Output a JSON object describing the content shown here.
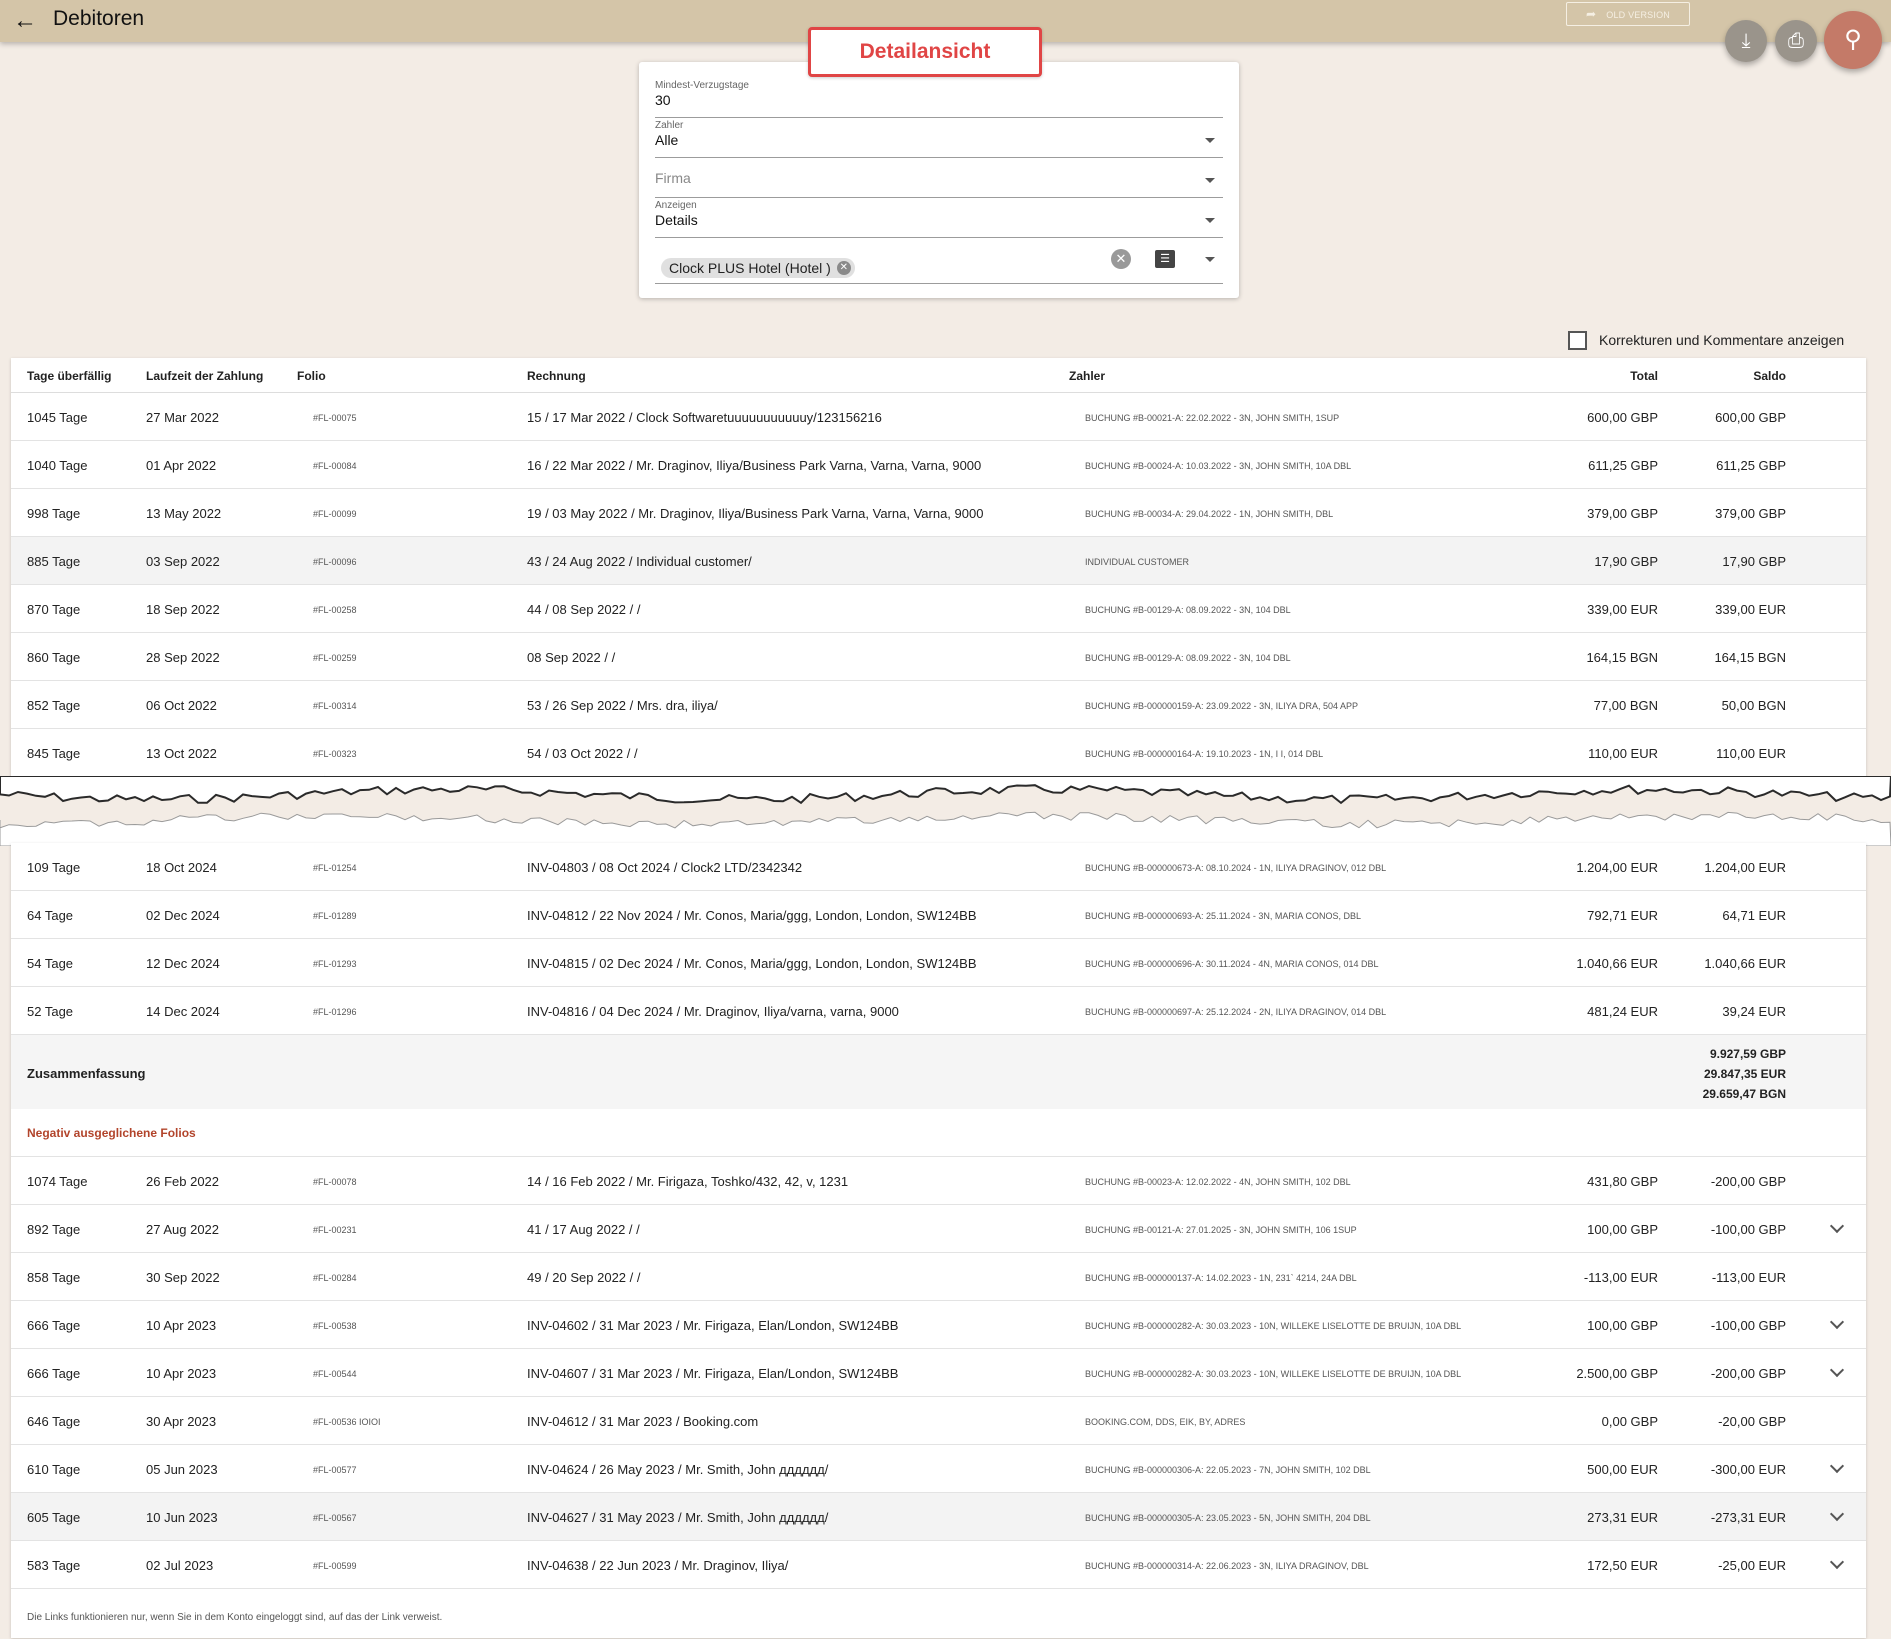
{
  "header": {
    "title": "Debitoren",
    "old_version_label": "OLD VERSION"
  },
  "callout": "Detailansicht",
  "filters": {
    "min_days_label": "Mindest-Verzugstage",
    "min_days_value": "30",
    "payer_label": "Zahler",
    "payer_value": "Alle",
    "company_placeholder": "Firma",
    "show_label": "Anzeigen",
    "show_value": "Details",
    "property_chip": "Clock PLUS Hotel (Hotel )"
  },
  "corrections_label": "Korrekturen und Kommentare anzeigen",
  "columns": {
    "days": "Tage überfällig",
    "term": "Laufzeit der Zahlung",
    "folio": "Folio",
    "invoice": "Rechnung",
    "payer": "Zahler",
    "total": "Total",
    "saldo": "Saldo"
  },
  "rows_top": [
    {
      "days": "1045 Tage",
      "date": "27 Mar 2022",
      "folio": "#FL-00075",
      "invoice": "15 / 17 Mar 2022 / Clock Softwaretuuuuuuuuuuuy/123156216",
      "payer": "BUCHUNG #B-00021-A: 22.02.2022 - 3N, JOHN SMITH, 1SUP",
      "total": "600,00 GBP",
      "saldo": "600,00 GBP"
    },
    {
      "days": "1040 Tage",
      "date": "01 Apr 2022",
      "folio": "#FL-00084",
      "invoice": "16 / 22 Mar 2022 / Mr. Draginov, Iliya/Business Park Varna, Varna, Varna, 9000",
      "payer": "BUCHUNG #B-00024-A: 10.03.2022 - 3N, JOHN SMITH, 10A DBL",
      "total": "611,25 GBP",
      "saldo": "611,25 GBP"
    },
    {
      "days": "998 Tage",
      "date": "13 May 2022",
      "folio": "#FL-00099",
      "invoice": "19 / 03 May 2022 / Mr. Draginov, Iliya/Business Park Varna, Varna, Varna, 9000",
      "payer": "BUCHUNG #B-00034-A: 29.04.2022 - 1N, JOHN SMITH, DBL",
      "total": "379,00 GBP",
      "saldo": "379,00 GBP"
    },
    {
      "days": "885 Tage",
      "date": "03 Sep 2022",
      "folio": "#FL-00096",
      "invoice": "43 / 24 Aug 2022 / Individual customer/",
      "payer": "INDIVIDUAL CUSTOMER",
      "total": "17,90 GBP",
      "saldo": "17,90 GBP",
      "shaded": true
    },
    {
      "days": "870 Tage",
      "date": "18 Sep 2022",
      "folio": "#FL-00258",
      "invoice": "44 / 08 Sep 2022 / /",
      "payer": "BUCHUNG #B-00129-A: 08.09.2022 - 3N, 104 DBL",
      "total": "339,00 EUR",
      "saldo": "339,00 EUR"
    },
    {
      "days": "860 Tage",
      "date": "28 Sep 2022",
      "folio": "#FL-00259",
      "invoice": "08 Sep 2022 / /",
      "payer": "BUCHUNG #B-00129-A: 08.09.2022 - 3N, 104 DBL",
      "total": "164,15 BGN",
      "saldo": "164,15 BGN"
    },
    {
      "days": "852 Tage",
      "date": "06 Oct 2022",
      "folio": "#FL-00314",
      "invoice": "53 / 26 Sep 2022 / Mrs. dra, iliya/",
      "payer": "BUCHUNG #B-000000159-A: 23.09.2022 - 3N, ILIYA DRA, 504 APP",
      "total": "77,00 BGN",
      "saldo": "50,00 BGN"
    },
    {
      "days": "845 Tage",
      "date": "13 Oct 2022",
      "folio": "#FL-00323",
      "invoice": "54 / 03 Oct 2022 / /",
      "payer": "BUCHUNG #B-000000164-A: 19.10.2023 - 1N, I I, 014 DBL",
      "total": "110,00 EUR",
      "saldo": "110,00 EUR"
    }
  ],
  "rows_bottom": [
    {
      "days": "109 Tage",
      "date": "18 Oct 2024",
      "folio": "#FL-01254",
      "invoice": "INV-04803 / 08 Oct 2024 / Clock2 LTD/2342342",
      "payer": "BUCHUNG #B-000000673-A: 08.10.2024 - 1N, ILIYA DRAGINOV, 012 DBL",
      "total": "1.204,00 EUR",
      "saldo": "1.204,00 EUR"
    },
    {
      "days": "64 Tage",
      "date": "02 Dec 2024",
      "folio": "#FL-01289",
      "invoice": "INV-04812 / 22 Nov 2024 / Mr. Conos, Maria/ggg, London, London, SW124BB",
      "payer": "BUCHUNG #B-000000693-A: 25.11.2024 - 3N, MARIA CONOS, DBL",
      "total": "792,71 EUR",
      "saldo": "64,71 EUR"
    },
    {
      "days": "54 Tage",
      "date": "12 Dec 2024",
      "folio": "#FL-01293",
      "invoice": "INV-04815 / 02 Dec 2024 / Mr. Conos, Maria/ggg, London, London, SW124BB",
      "payer": "BUCHUNG #B-000000696-A: 30.11.2024 - 4N, MARIA CONOS, 014 DBL",
      "total": "1.040,66 EUR",
      "saldo": "1.040,66 EUR"
    },
    {
      "days": "52 Tage",
      "date": "14 Dec 2024",
      "folio": "#FL-01296",
      "invoice": "INV-04816 / 04 Dec 2024 / Mr. Draginov, Iliya/varna, varna, 9000",
      "payer": "BUCHUNG #B-000000697-A: 25.12.2024 - 2N, ILIYA DRAGINOV, 014 DBL",
      "total": "481,24 EUR",
      "saldo": "39,24 EUR"
    }
  ],
  "summary": {
    "label": "Zusammenfassung",
    "totals": [
      "9.927,59 GBP",
      "29.847,35 EUR",
      "29.659,47 BGN"
    ]
  },
  "negative_heading": "Negativ ausgeglichene Folios",
  "rows_negative": [
    {
      "days": "1074 Tage",
      "date": "26 Feb 2022",
      "folio": "#FL-00078",
      "invoice": "14 / 16 Feb 2022 / Mr. Firigaza, Toshko/432, 42, v, 1231",
      "payer": "BUCHUNG #B-00023-A: 12.02.2022 - 4N, JOHN SMITH, 102 DBL",
      "total": "431,80 GBP",
      "saldo": "-200,00 GBP",
      "expand": false
    },
    {
      "days": "892 Tage",
      "date": "27 Aug 2022",
      "folio": "#FL-00231",
      "invoice": "41 / 17 Aug 2022 / /",
      "payer": "BUCHUNG #B-00121-A: 27.01.2025 - 3N, JOHN SMITH, 106 1SUP",
      "total": "100,00 GBP",
      "saldo": "-100,00 GBP",
      "expand": true
    },
    {
      "days": "858 Tage",
      "date": "30 Sep 2022",
      "folio": "#FL-00284",
      "invoice": "49 / 20 Sep 2022 / /",
      "payer": "BUCHUNG #B-000000137-A: 14.02.2023 - 1N, 231` 4214, 24A DBL",
      "total": "-113,00 EUR",
      "saldo": "-113,00 EUR",
      "expand": false
    },
    {
      "days": "666 Tage",
      "date": "10 Apr 2023",
      "folio": "#FL-00538",
      "invoice": "INV-04602 / 31 Mar 2023 / Mr. Firigaza, Elan/London, SW124BB",
      "payer": "BUCHUNG #B-000000282-A: 30.03.2023 - 10N, WILLEKE LISELOTTE DE BRUIJN, 10A DBL",
      "total": "100,00 GBP",
      "saldo": "-100,00 GBP",
      "expand": true
    },
    {
      "days": "666 Tage",
      "date": "10 Apr 2023",
      "folio": "#FL-00544",
      "invoice": "INV-04607 / 31 Mar 2023 / Mr. Firigaza, Elan/London, SW124BB",
      "payer": "BUCHUNG #B-000000282-A: 30.03.2023 - 10N, WILLEKE LISELOTTE DE BRUIJN, 10A DBL",
      "total": "2.500,00 GBP",
      "saldo": "-200,00 GBP",
      "expand": true
    },
    {
      "days": "646 Tage",
      "date": "30 Apr 2023",
      "folio": "#FL-00536 IOIOI",
      "invoice": "INV-04612 / 31 Mar 2023 / Booking.com",
      "payer": "BOOKING.COM, DDS, EIK, BY, ADRES",
      "total": "0,00 GBP",
      "saldo": "-20,00 GBP",
      "expand": false
    },
    {
      "days": "610 Tage",
      "date": "05 Jun 2023",
      "folio": "#FL-00577",
      "invoice": "INV-04624 / 26 May 2023 / Mr. Smith, John дддддд/",
      "payer": "BUCHUNG #B-000000306-A: 22.05.2023 - 7N, JOHN SMITH, 102 DBL",
      "total": "500,00 EUR",
      "saldo": "-300,00 EUR",
      "expand": true
    },
    {
      "days": "605 Tage",
      "date": "10 Jun 2023",
      "folio": "#FL-00567",
      "invoice": "INV-04627 / 31 May 2023 / Mr. Smith, John дддддд/",
      "payer": "BUCHUNG #B-000000305-A: 23.05.2023 - 5N, JOHN SMITH, 204 DBL",
      "total": "273,31 EUR",
      "saldo": "-273,31 EUR",
      "expand": true,
      "shaded": true
    },
    {
      "days": "583 Tage",
      "date": "02 Jul 2023",
      "folio": "#FL-00599",
      "invoice": "INV-04638 / 22 Jun 2023 / Mr. Draginov, Iliya/",
      "payer": "BUCHUNG #B-000000314-A: 22.06.2023 - 3N, ILIYA DRAGINOV, DBL",
      "total": "172,50 EUR",
      "saldo": "-25,00 EUR",
      "expand": true
    }
  ],
  "footnote": "Die Links funktionieren nur, wenn Sie in dem Konto eingeloggt sind, auf das der Link verweist."
}
